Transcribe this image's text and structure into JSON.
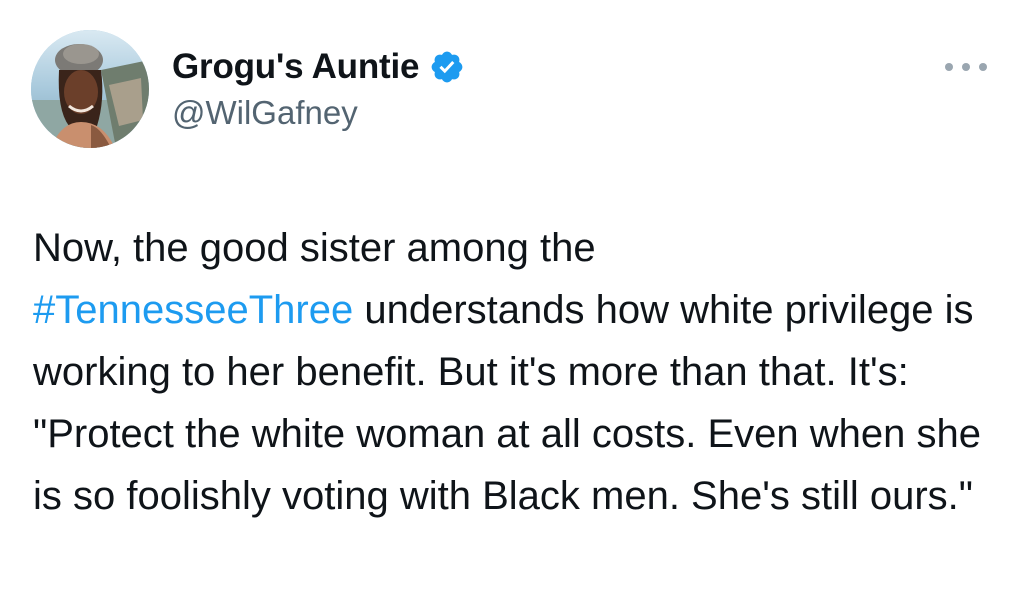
{
  "author": {
    "display_name": "Grogu's Auntie",
    "handle": "@WilGafney",
    "verified_icon": "verified-badge-icon",
    "avatar_icon": "profile-photo"
  },
  "menu": {
    "icon": "more-horizontal-icon"
  },
  "tweet": {
    "text_before_hashtag": "Now, the good sister among the ",
    "hashtag": "#TennesseeThree",
    "text_after_hashtag": " understands how white privilege is working to her benefit. But it's more than that. It's: \"Protect the white woman at all costs. Even when she is so foolishly voting with Black men. She's still ours.\""
  },
  "colors": {
    "link": "#1d9bf0",
    "handle": "#536471",
    "text": "#0f1419",
    "verified": "#1d9bf0"
  }
}
